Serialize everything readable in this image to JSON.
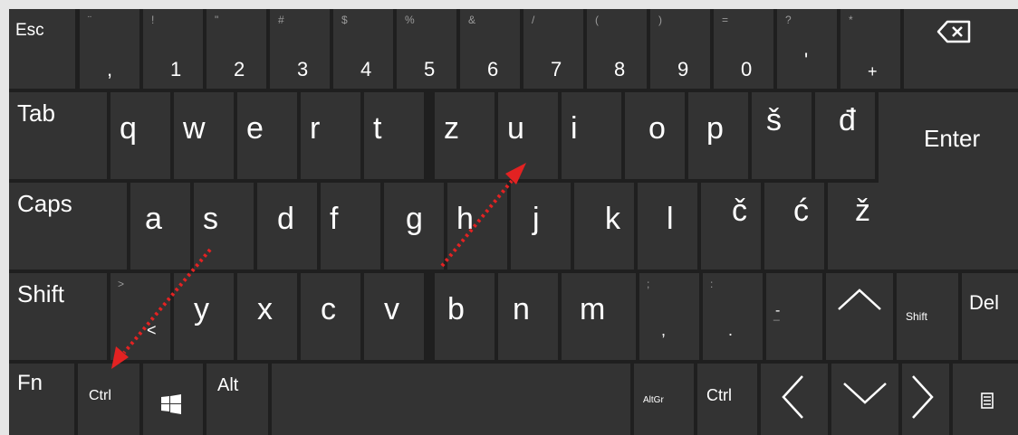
{
  "keyboard": {
    "row1": {
      "esc": "Esc",
      "keys": [
        {
          "main": ",",
          "sec": "¨"
        },
        {
          "main": "1",
          "sec": "!"
        },
        {
          "main": "2",
          "sec": "\""
        },
        {
          "main": "3",
          "sec": "#"
        },
        {
          "main": "4",
          "sec": "$"
        },
        {
          "main": "5",
          "sec": "%"
        },
        {
          "main": "6",
          "sec": "&"
        },
        {
          "main": "7",
          "sec": "/"
        },
        {
          "main": "8",
          "sec": "("
        },
        {
          "main": "9",
          "sec": ")"
        },
        {
          "main": "0",
          "sec": "="
        },
        {
          "main": "'",
          "sec": "?"
        },
        {
          "main": "+",
          "sec": "*"
        }
      ],
      "backspace_icon": "backspace-icon"
    },
    "row2": {
      "tab": "Tab",
      "keys": [
        "q",
        "w",
        "e",
        "r",
        "t",
        "z",
        "u",
        "i",
        "o",
        "p",
        "š",
        "đ"
      ],
      "enter": "Enter"
    },
    "row3": {
      "caps": "Caps",
      "keys": [
        "a",
        "s",
        "d",
        "f",
        "g",
        "h",
        "j",
        "k",
        "l",
        "č",
        "ć",
        "ž"
      ]
    },
    "row4": {
      "shift": "Shift",
      "angle": {
        "main": "<",
        "sec": ">"
      },
      "keys": [
        "y",
        "x",
        "c",
        "v",
        "b",
        "n",
        "m"
      ],
      "punct": [
        {
          "main": ",",
          "sec": ";"
        },
        {
          "main": ".",
          "sec": ":"
        },
        {
          "main": "-",
          "sec": "_"
        }
      ],
      "shift_small": "Shift",
      "del": "Del"
    },
    "row5": {
      "fn": "Fn",
      "ctrl_left": "Ctrl",
      "alt": "Alt",
      "altgr": "AltGr",
      "ctrl_right": "Ctrl"
    },
    "annotation_color": "#e32222"
  }
}
